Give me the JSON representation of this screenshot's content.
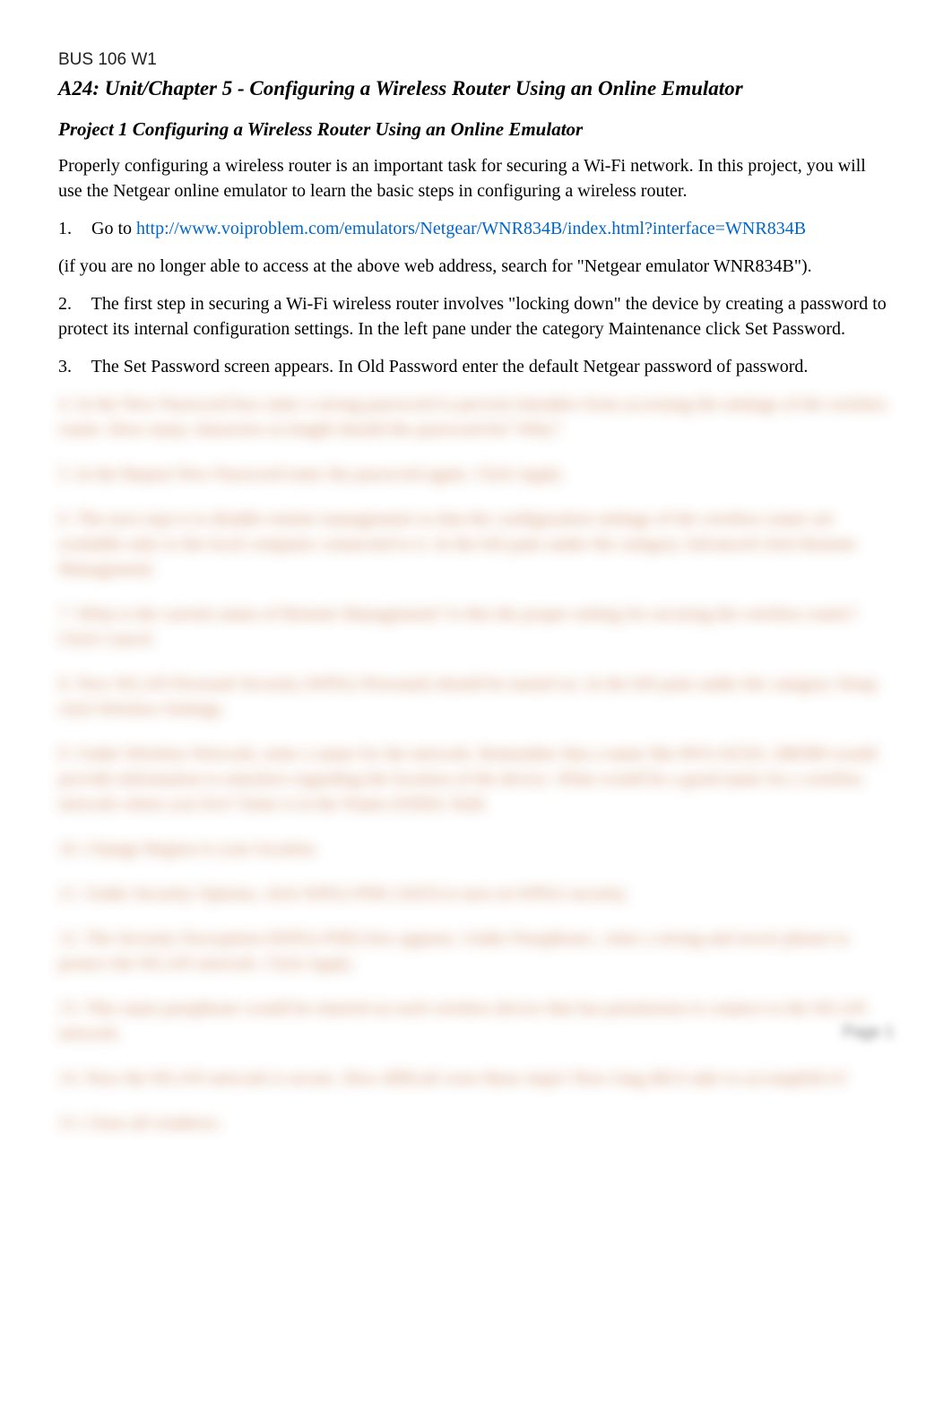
{
  "course_code": "BUS 106 W1",
  "doc_title": "A24: Unit/Chapter 5 - Configuring a Wireless Router Using an Online Emulator",
  "project_title": "Project 1 Configuring a Wireless Router Using an Online Emulator",
  "intro": "Properly configuring a wireless router is an important task for securing a Wi-Fi network. In this project, you will use the Netgear online emulator to learn the basic steps in configuring a wireless router.",
  "step1_num": "1.",
  "step1_text": "Go to ",
  "step1_link": "http://www.voiproblem.com/emulators/Netgear/WNR834B/index.html?interface=WNR834B",
  "step1_note": " (if you are no longer able to access at the above web address, search for \"Netgear emulator WNR834B\").",
  "step2_num": "2.",
  "step2_text": "The first step in securing a Wi-Fi wireless router involves \"locking down\" the device by creating a password to protect its internal configuration settings. In the left pane under the category Maintenance click Set Password.",
  "step3_num": "3.",
  "step3_text": "The Set Password screen appears. In Old Password enter the default Netgear password of password.",
  "blurred": {
    "s4": "4.    In the New Password box enter a strong password to prevent intruders from accessing the settings of the wireless router. How many characters in length should the password be? Why?",
    "s5": "5.    In the Repeat New Password enter the password again. Click Apply.",
    "s6": "6.    The next step is to disable remote management so that the configuration settings of the wireless router are available only to the local computer connected to it. In the left pane under the category Advanced click Remote Management.",
    "s7": "7.    What is the current status of Remote Management? Is this the proper setting for securing the wireless router? Click Cancel.",
    "s8": "8.    Now WLAN Personal Security (WPA2-Personal) should be turned on. In the left pane under the category Setup click Wireless Settings.",
    "s9": "9.    Under Wireless Network, enter a name for the network. Remember that a name like RVA-0232L-280300 would provide information to attackers regarding the location of the device. What would be a good name for a wireless network where you live? Enter it in the Name (SSID): field.",
    "s10": "10.    Change Region to your location.",
    "s11": "11.    Under Security Options, click WPA2-PSK [AES] to turn on WPA2 security.",
    "s12": "12.    The Security Encryption (WPA2-PSK) box appears. Under Passphrase:, enter a strong and secret phrase to protect the WLAN network. Click Apply.",
    "s13": "13.    This same passphrase would be entered on each wireless device that has permission to connect to the WLAN network.",
    "s14": "14.    Now the WLAN network is secure. How difficult were these steps? How long did it take to accomplish it?",
    "s15": "15.    Close all windows."
  },
  "page_label": "Page 1"
}
